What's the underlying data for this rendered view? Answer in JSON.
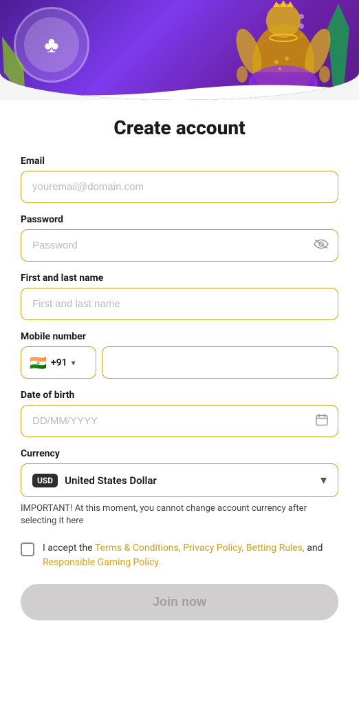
{
  "hero": {
    "alt": "Casino decorative banner"
  },
  "page": {
    "title": "Create account"
  },
  "form": {
    "email": {
      "label": "Email",
      "placeholder": "youremail@domain.com"
    },
    "password": {
      "label": "Password",
      "placeholder": "Password"
    },
    "fullname": {
      "label": "First and last name",
      "placeholder": "First and last name"
    },
    "mobile": {
      "label": "Mobile number",
      "flag": "🇮🇳",
      "country_code": "+91",
      "placeholder": ""
    },
    "dob": {
      "label": "Date of birth",
      "placeholder": "DD/MM/YYYY"
    },
    "currency": {
      "label": "Currency",
      "code": "USD",
      "name": "United States Dollar"
    }
  },
  "important_note": "IMPORTANT! At this moment, you cannot change account currency after selecting it here",
  "terms": {
    "text_before": "I accept the ",
    "link1": "Terms & Conditions, Privacy Policy,",
    "text_middle": " ",
    "link2": "Betting Rules,",
    "text_and": " and ",
    "link3": "Responsible Gaming Policy."
  },
  "join_button": "Join now"
}
